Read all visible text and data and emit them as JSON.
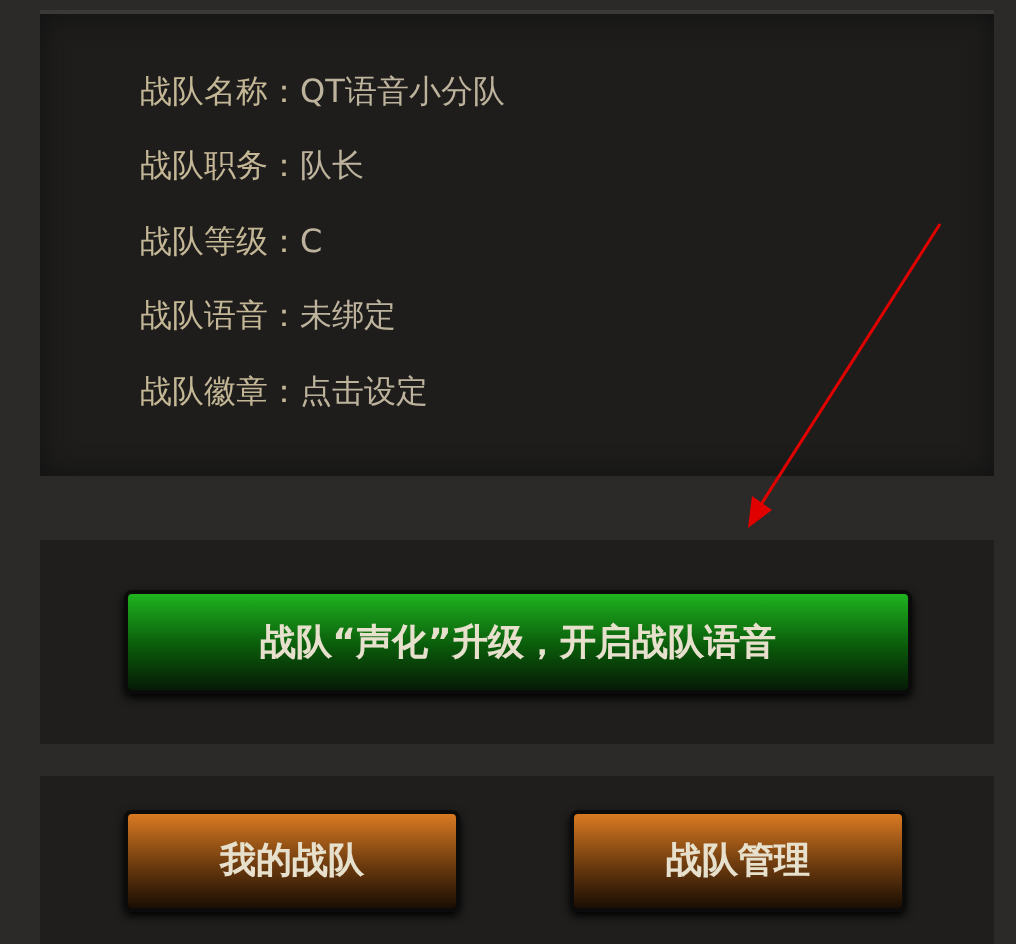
{
  "info_rows": [
    {
      "label": "战队名称：",
      "value": "QT语音小分队"
    },
    {
      "label": "战队职务：",
      "value": "队长"
    },
    {
      "label": "战队等级：",
      "value": "C"
    },
    {
      "label": "战队语音：",
      "value": "未绑定"
    },
    {
      "label": "战队徽章：",
      "value": "点击设定"
    }
  ],
  "upgrade_button": {
    "label": "战队“声化”升级，开启战队语音"
  },
  "buttons": [
    {
      "label": "我的战队"
    },
    {
      "label": "战队管理"
    }
  ]
}
